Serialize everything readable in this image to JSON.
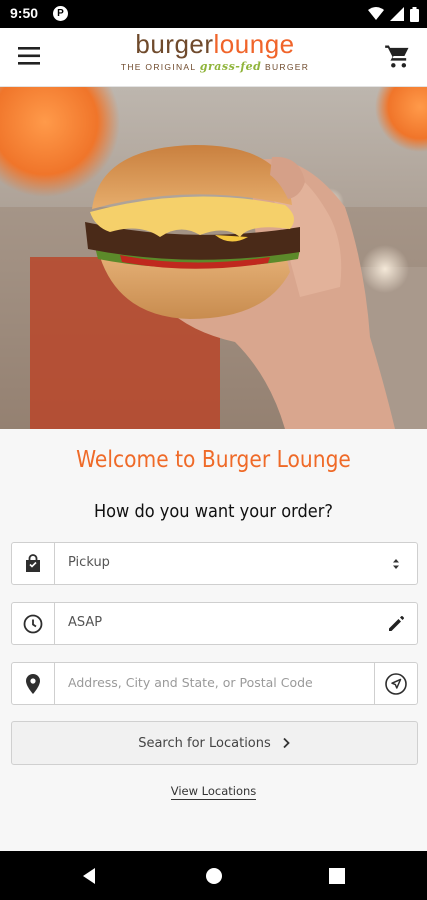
{
  "status_bar": {
    "time": "9:50",
    "app_badge": "P",
    "icons": [
      "wifi-icon",
      "signal-icon",
      "battery-icon"
    ]
  },
  "app_bar": {
    "menu_icon": "hamburger-menu-icon",
    "cart_icon": "shopping-cart-icon",
    "logo": {
      "word1": "burger",
      "word2": "lounge",
      "tagline_pre": "THE ORIGINAL",
      "tagline_mid": "grass-fed",
      "tagline_post": "BURGER"
    }
  },
  "hero": {
    "image": "hand holding cheeseburger"
  },
  "main": {
    "welcome": "Welcome to Burger Lounge",
    "question": "How do you want your order?",
    "order_type": {
      "value": "Pickup",
      "icon": "shopping-bag-icon",
      "trail_icon": "dropdown-arrows-icon"
    },
    "time": {
      "value": "ASAP",
      "icon": "clock-icon",
      "trail_icon": "pencil-icon"
    },
    "address": {
      "placeholder": "Address, City and State, or Postal Code",
      "icon": "location-pin-icon",
      "trail_icon": "navigation-icon"
    },
    "search_button": "Search for Locations",
    "view_locations": "View Locations"
  },
  "colors": {
    "accent": "#ef6a28",
    "brand_brown": "#6f4a2c",
    "brand_green": "#8fb43a"
  },
  "nav_bar": {
    "icons": [
      "back-icon",
      "home-icon",
      "recents-icon"
    ]
  }
}
